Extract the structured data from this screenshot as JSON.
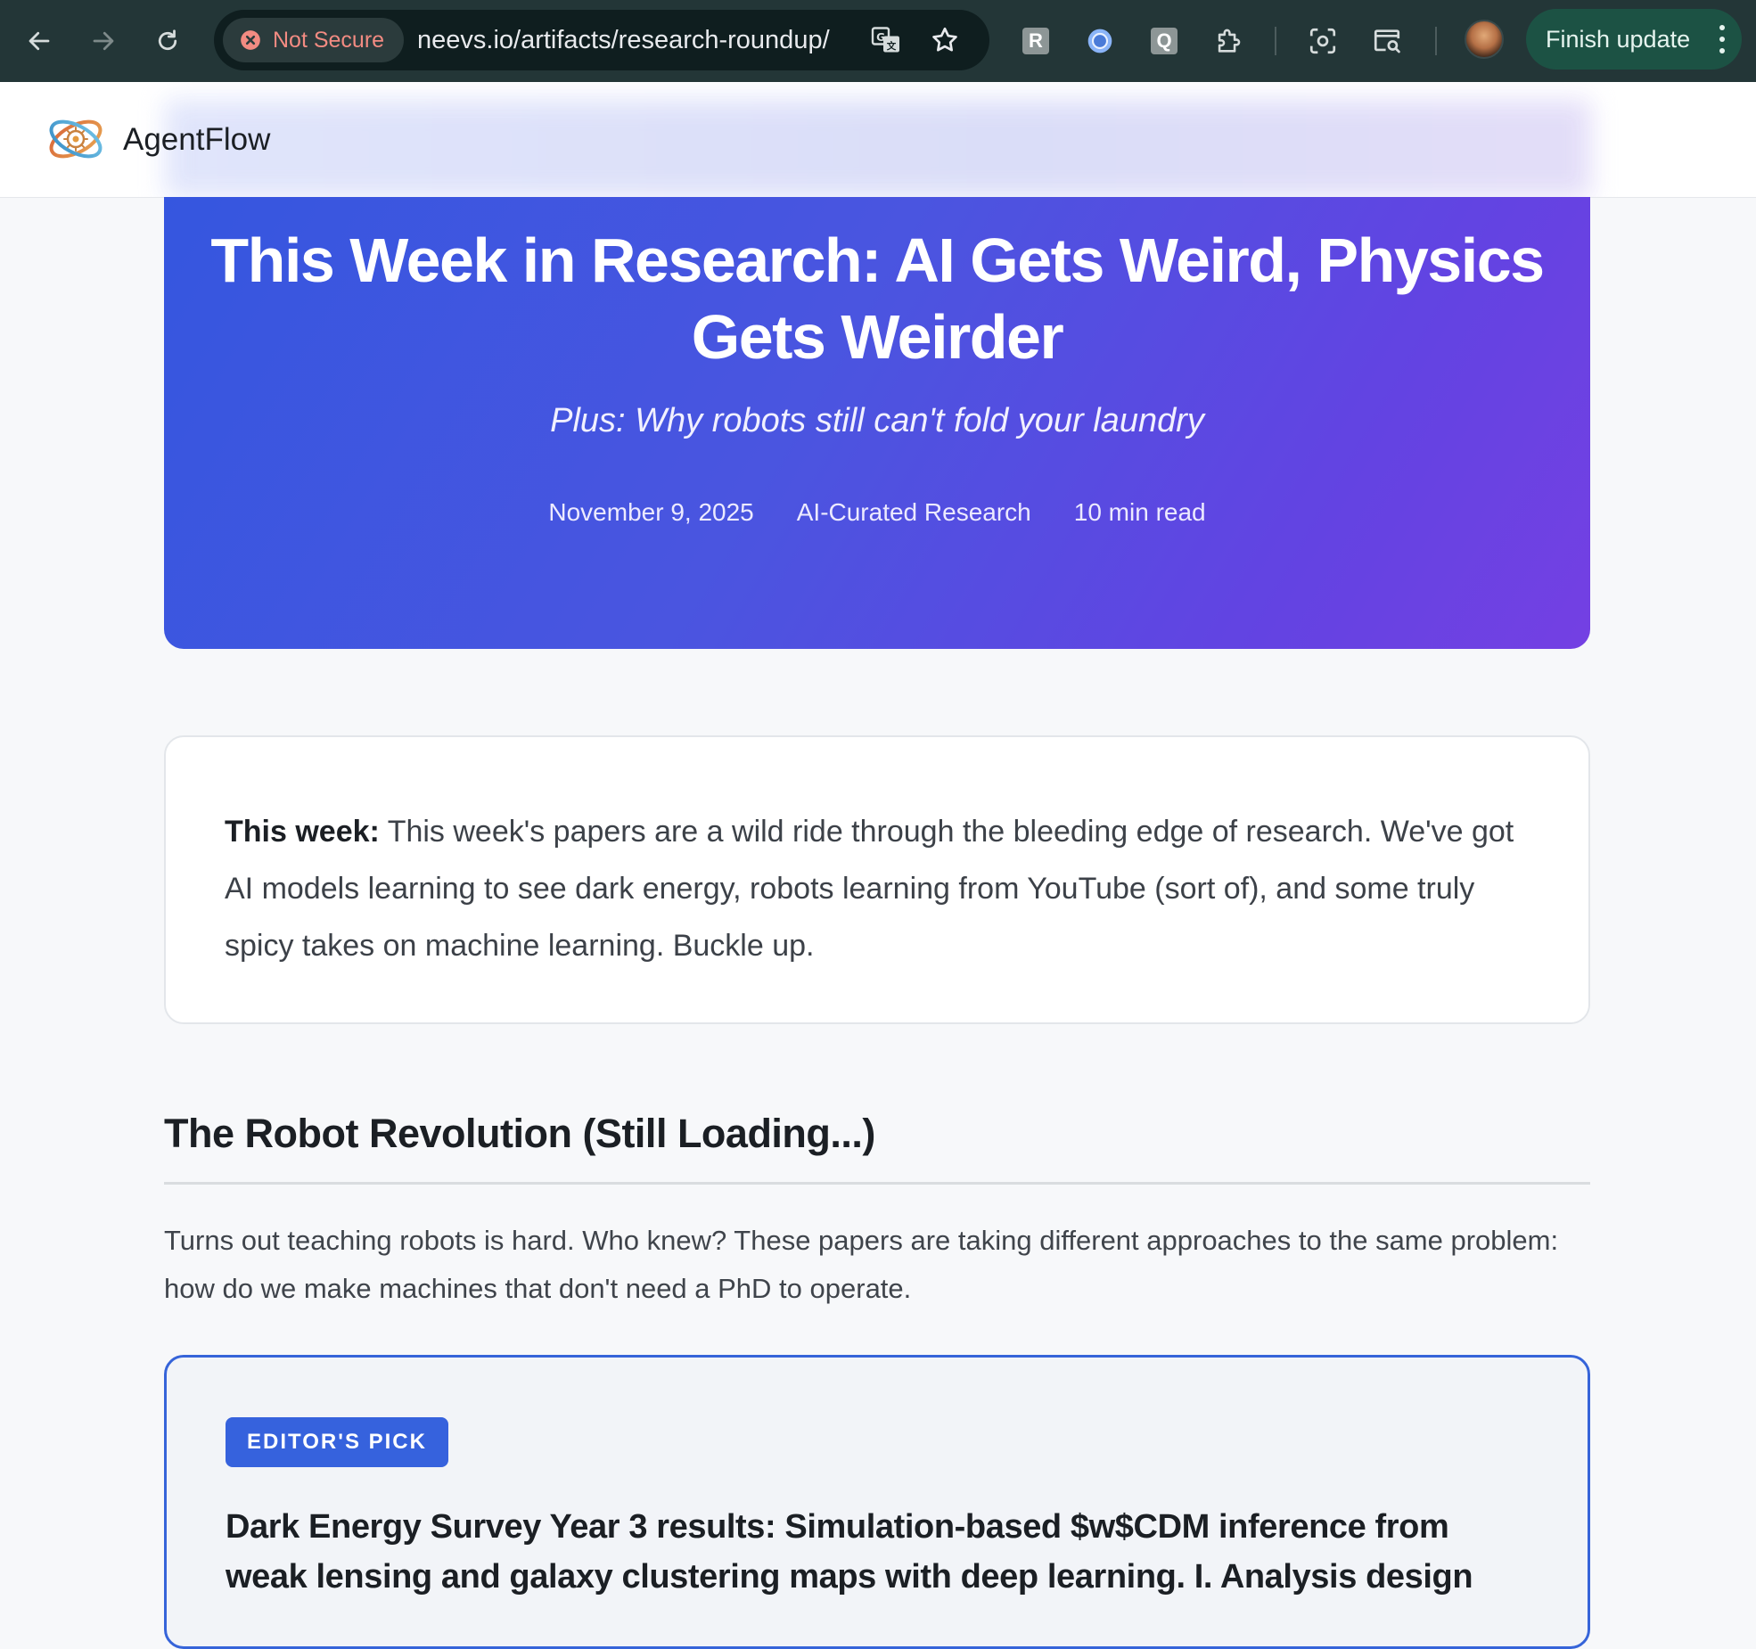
{
  "browser": {
    "security_label": "Not Secure",
    "url": "neevs.io/artifacts/research-roundup/",
    "extension_r": "R",
    "extension_q": "Q",
    "finish_update_label": "Finish update"
  },
  "site": {
    "brand": "AgentFlow"
  },
  "hero": {
    "title": "This Week in Research: AI Gets Weird, Physics Gets Weirder",
    "subtitle": "Plus: Why robots still can't fold your laundry",
    "date": "November 9, 2025",
    "category": "AI-Curated Research",
    "read_time": "10 min read"
  },
  "summary": {
    "lead": "This week:",
    "text": "This week's papers are a wild ride through the bleeding edge of research. We've got AI models learning to see dark energy, robots learning from YouTube (sort of), and some truly spicy takes on machine learning. Buckle up."
  },
  "section": {
    "title": "The Robot Revolution (Still Loading...)",
    "intro": "Turns out teaching robots is hard. Who knew? These papers are taking different approaches to the same problem: how do we make machines that don't need a PhD to operate."
  },
  "paper": {
    "badge": "EDITOR'S PICK",
    "title": "Dark Energy Survey Year 3 results: Simulation-based $w$CDM inference from weak lensing and galaxy clustering maps with deep learning. I. Analysis design"
  },
  "icons": {
    "back": "arrow-left-icon",
    "forward": "arrow-right-icon",
    "reload": "reload-icon",
    "translate": "translate-icon",
    "bookmark": "star-icon",
    "extensions": "puzzle-icon",
    "screenshot": "screen-capture-icon",
    "lens": "search-page-icon"
  },
  "colors": {
    "chrome_bg": "#233637",
    "hero_gradient_start": "#3556df",
    "hero_gradient_end": "#7440e3",
    "accent": "#3664d9",
    "warning_text": "#f28b82",
    "update_button": "#1c5244"
  }
}
